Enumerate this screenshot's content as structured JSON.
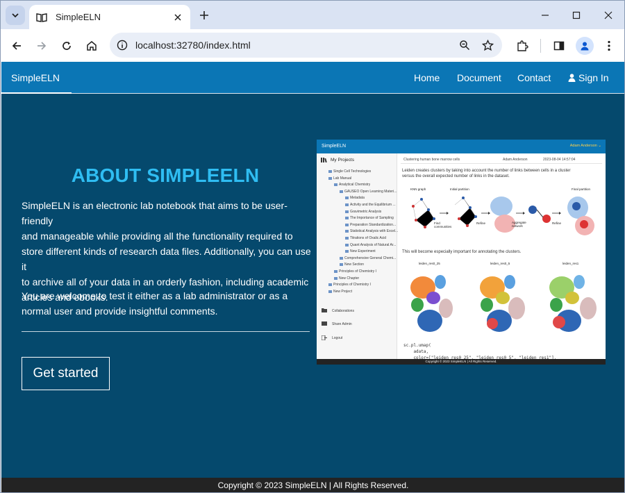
{
  "browser": {
    "tab_title": "SimpleELN",
    "url": "localhost:32780/index.html"
  },
  "site": {
    "brand": "SimpleELN",
    "nav": {
      "home": "Home",
      "document": "Document",
      "contact": "Contact",
      "signin": "Sign In"
    },
    "title": "ABOUT SIMPLEELN",
    "paragraph1_lines": [
      "SimpleELN is an electronic lab notebook that aims to be user-friendly",
      "and manageable while providing all the functionality required to",
      "store different kinds of research data files. Additionally, you can use it",
      "to archive all of your data in an orderly fashion, including academic",
      "articles and ebooks."
    ],
    "paragraph2_lines": [
      "You are welcome to test it either as a lab administrator or as a",
      "normal user and provide insightful comments."
    ],
    "cta": "Get started",
    "footer": "Copyright © 2023 SimpleELN | All Rights Reserved."
  },
  "preview": {
    "brand": "SimpleELN",
    "user": "Adam Anderson ⌄",
    "sidebar_heading": "My Projects",
    "tree": [
      "Single Cell Technologies",
      "Lab Manual",
      "Analytical Chemistry",
      "GAUSEO Open Learning Materi...",
      "Metadata",
      "Activity and the Equilibrium ...",
      "Gravimetric Analysis",
      "The Importance of Sampling",
      "Preparation Standardization...",
      "Statistical Analysis with Excel...",
      "Titrations of Oxalic Acid",
      "Quant Analysis of Natural Ar...",
      "New Experiment",
      "Comprehensive General Chemi...",
      "New Section",
      "Principles of Chemistry I",
      "New Chapter",
      "Principles of Chemistry I",
      "New Project"
    ],
    "bottom_links": [
      "Collaborations",
      "Share Admin",
      "Logout"
    ],
    "header_title": "Clustering human bone marrow cells",
    "header_author": "Adam Anderson",
    "header_date": "2023-08-04 14:57:04",
    "intro_lines": [
      "Leiden creates clusters by taking into account the number of links between cells in a cluster",
      "versus the overall expected number of links in the dataset."
    ],
    "diagram_labels": [
      "KNN graph",
      "Initial partition",
      "Final partition",
      "Find communities",
      "Refine",
      "Aggregate network",
      "Refine"
    ],
    "annotate_text": "This will become especially important for annotating the clusters.",
    "umap_titles": [
      "leiden_res0_25",
      "leiden_res0_5",
      "leiden_res1"
    ],
    "code_lines": [
      "sc.pl.umap(",
      "    adata,",
      "    color=[\"leiden_res0_25\", \"leiden_res0_5\", \"leiden_res1\"],"
    ],
    "footer": "Copyright © 2023 SimpleELN | All Rights Reserved."
  },
  "colors": {
    "navbar": "#0b76b5",
    "page_bg": "#05496d",
    "title": "#2fbdf2",
    "footer": "#232323"
  }
}
